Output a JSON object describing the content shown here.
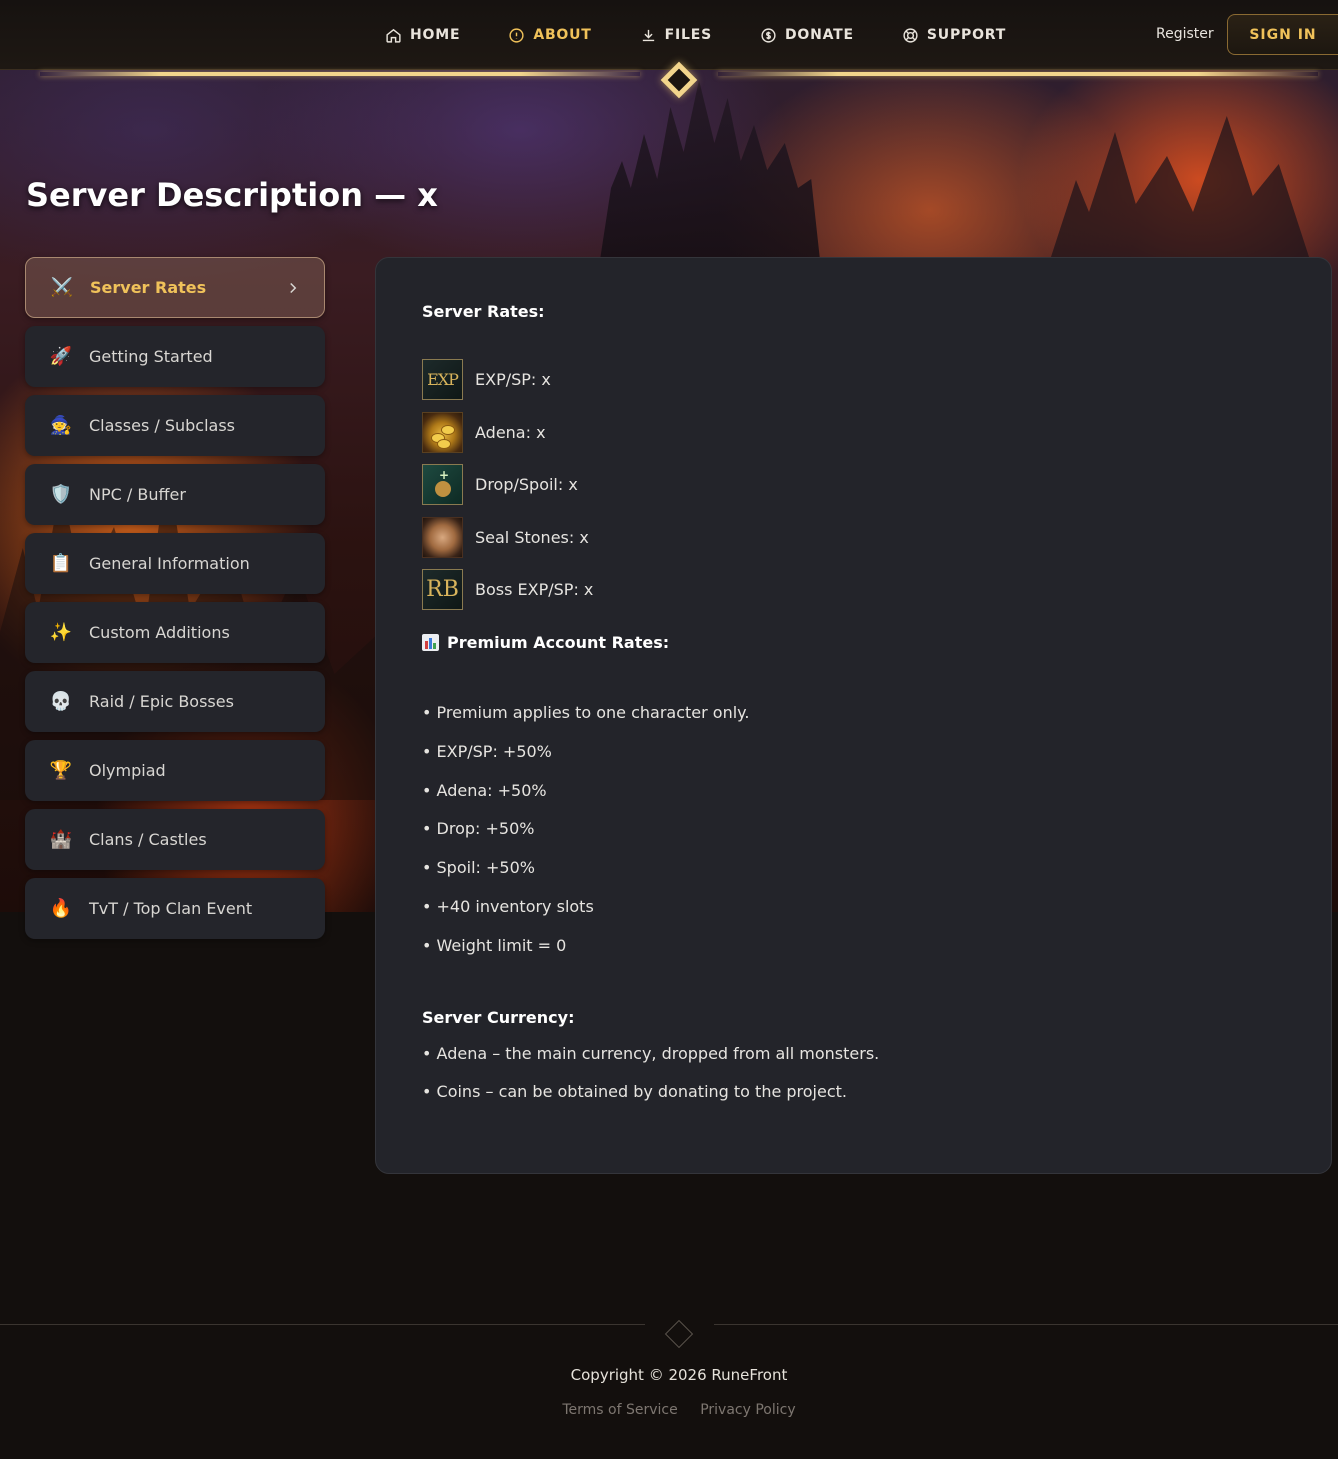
{
  "nav": {
    "items": [
      {
        "label": "HOME",
        "icon": "home-icon",
        "active": false
      },
      {
        "label": "ABOUT",
        "icon": "info-icon",
        "active": true
      },
      {
        "label": "FILES",
        "icon": "download-icon",
        "active": false
      },
      {
        "label": "DONATE",
        "icon": "dollar-circle-icon",
        "active": false
      },
      {
        "label": "SUPPORT",
        "icon": "lifebuoy-icon",
        "active": false
      }
    ],
    "register": "Register",
    "sign_in": "SIGN IN"
  },
  "page": {
    "title": "Server Description — x"
  },
  "sidebar": {
    "items": [
      {
        "label": "Server Rates",
        "icon": "⚔️",
        "active": true
      },
      {
        "label": "Getting Started",
        "icon": "🚀",
        "active": false
      },
      {
        "label": "Classes / Subclass",
        "icon": "🧙",
        "active": false
      },
      {
        "label": "NPC / Buffer",
        "icon": "🛡️",
        "active": false
      },
      {
        "label": "General Information",
        "icon": "📋",
        "active": false
      },
      {
        "label": "Custom Additions",
        "icon": "✨",
        "active": false
      },
      {
        "label": "Raid / Epic Bosses",
        "icon": "💀",
        "active": false
      },
      {
        "label": "Olympiad",
        "icon": "🏆",
        "active": false
      },
      {
        "label": "Clans / Castles",
        "icon": "🏰",
        "active": false
      },
      {
        "label": "TvT / Top Clan Event",
        "icon": "🔥",
        "active": false
      }
    ]
  },
  "content": {
    "rates_heading": "Server Rates:",
    "rates": [
      {
        "label": "EXP/SP: x",
        "icon": "exp-icon",
        "icon_text": "EXP"
      },
      {
        "label": "Adena: x",
        "icon": "adena-coins-icon",
        "icon_text": ""
      },
      {
        "label": "Drop/Spoil: x",
        "icon": "drop-bag-icon",
        "icon_text": ""
      },
      {
        "label": "Seal Stones: x",
        "icon": "seal-stone-icon",
        "icon_text": ""
      },
      {
        "label": "Boss EXP/SP: x",
        "icon": "raid-boss-icon",
        "icon_text": "RB"
      }
    ],
    "premium_heading": "Premium Account Rates:",
    "premium_bullets": [
      "• Premium applies to one character only.",
      "• EXP/SP: +50%",
      "• Adena: +50%",
      "• Drop: +50%",
      "• Spoil: +50%",
      "• +40 inventory slots",
      "• Weight limit = 0"
    ],
    "currency_heading": "Server Currency:",
    "currency_bullets": [
      "• Adena – the main currency, dropped from all monsters.",
      "• Coins – can be obtained by donating to the project."
    ]
  },
  "footer": {
    "copyright": "Copyright © 2026 RuneFront",
    "links": [
      "Terms of Service",
      "Privacy Policy"
    ]
  },
  "colors": {
    "accent_gold": "#f0c25a",
    "panel_bg": "#23242a",
    "page_bg": "#130f0d"
  }
}
